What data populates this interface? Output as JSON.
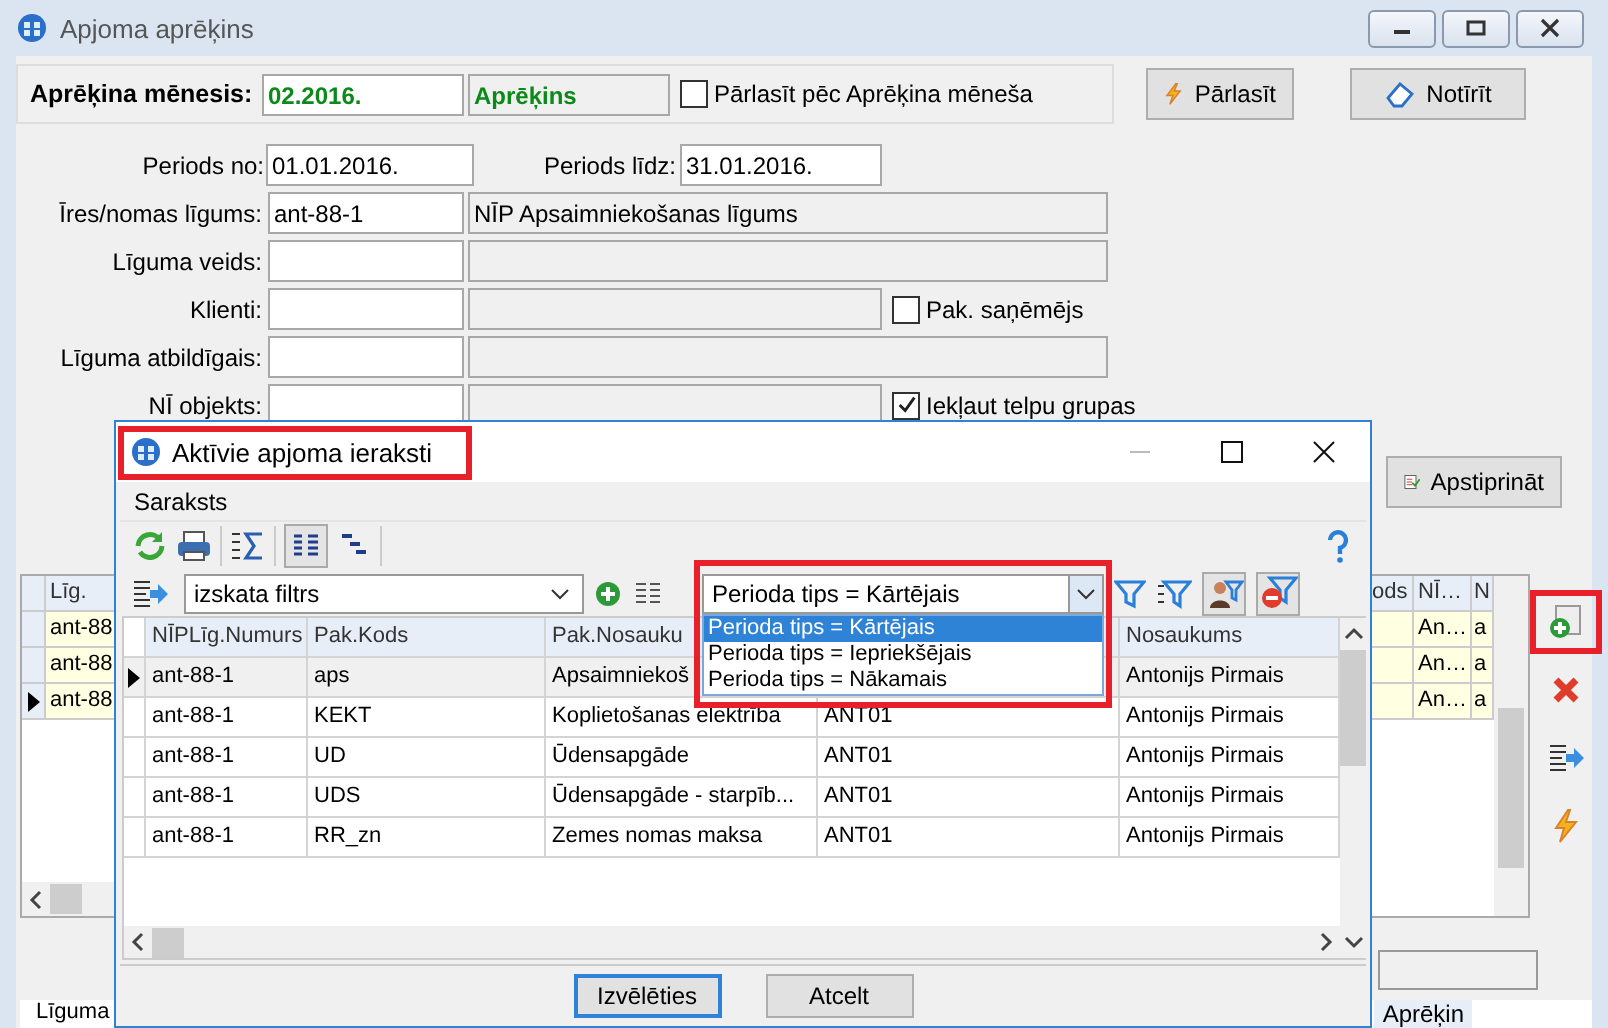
{
  "window": {
    "title": "Apjoma aprēķins"
  },
  "month_panel": {
    "label": "Aprēķina mēnesis:",
    "month": "02.2016.",
    "status": "Aprēķins",
    "reread_checkbox": {
      "label": "Pārlasīt pēc Aprēķina mēneša",
      "checked": false
    }
  },
  "reread_button": "Pārlasīt",
  "clear_button": "Notīrīt",
  "period": {
    "from_label": "Periods no:",
    "from": "01.01.2016.",
    "to_label": "Periods līdz:",
    "to": "31.01.2016."
  },
  "form_rows": [
    {
      "label": "Īres/nomas līgums:",
      "code": "ant-88-1",
      "name": "NĪP Apsaimniekošanas līgums",
      "kind": "wide"
    },
    {
      "label": "Līguma veids:",
      "kind": "wide"
    },
    {
      "label": "Klienti:",
      "kind": "checkbox",
      "checkbox": {
        "label": "Pak. saņēmējs",
        "checked": false
      }
    },
    {
      "label": "Līguma atbildīgais:",
      "kind": "wide"
    },
    {
      "label": "NĪ objekts:",
      "kind": "checkbox",
      "checkbox": {
        "label": "Iekļaut telpu grupas",
        "checked": true
      }
    }
  ],
  "approve_button": "Apstiprināt",
  "background_table": {
    "left_header": "Līg.",
    "right_headers": [
      "ods",
      "NĪ…",
      "N"
    ],
    "rows": [
      {
        "selected": false,
        "left": "ant-88",
        "right": [
          "An…",
          "a"
        ]
      },
      {
        "selected": false,
        "left": "ant-88",
        "right": [
          "An…",
          "a"
        ]
      },
      {
        "selected": true,
        "left": "ant-88",
        "right": [
          "An…",
          "a"
        ]
      }
    ]
  },
  "side_tools": [
    {
      "kind": "add",
      "highlighted": true
    },
    {
      "kind": "delete",
      "highlighted": false
    },
    {
      "kind": "import",
      "highlighted": false
    },
    {
      "kind": "run",
      "highlighted": false
    }
  ],
  "bottom_table": {
    "headers": [
      "Līguma",
      "Aprēķin"
    ]
  },
  "dialog": {
    "title": "Aktīvie apjoma ieraksti",
    "highlighted": true,
    "menu": "Saraksts",
    "view_filter": "izskata filtrs",
    "period_filter": {
      "value": "Perioda tips = Kārtējais",
      "highlighted": true,
      "options": [
        {
          "label": "Perioda tips = Kārtējais",
          "selected": true
        },
        {
          "label": "Perioda tips = Iepriekšējais",
          "selected": false
        },
        {
          "label": "Perioda tips = Nākamais",
          "selected": false
        }
      ]
    },
    "table": {
      "columns": [
        "NĪPLīg.Numurs",
        "Pak.Kods",
        "Pak.Nosauku",
        "",
        "Nosaukums"
      ],
      "rows": [
        {
          "selected": true,
          "cells": [
            "ant-88-1",
            "aps",
            "Apsaimniekoš",
            "",
            "Antonijs Pirmais"
          ]
        },
        {
          "selected": false,
          "cells": [
            "ant-88-1",
            "KEKT",
            "Koplietošanas elektrība",
            "ANT01",
            "Antonijs Pirmais"
          ]
        },
        {
          "selected": false,
          "cells": [
            "ant-88-1",
            "UD",
            "Ūdensapgāde",
            "ANT01",
            "Antonijs Pirmais"
          ]
        },
        {
          "selected": false,
          "cells": [
            "ant-88-1",
            "UDS",
            "Ūdensapgāde - starpīb...",
            "ANT01",
            "Antonijs Pirmais"
          ]
        },
        {
          "selected": false,
          "cells": [
            "ant-88-1",
            "RR_zn",
            "Zemes nomas maksa",
            "ANT01",
            "Antonijs Pirmais"
          ]
        }
      ]
    },
    "buttons": [
      {
        "label": "Izvēlēties",
        "default": true
      },
      {
        "label": "Atcelt",
        "default": false
      }
    ]
  }
}
